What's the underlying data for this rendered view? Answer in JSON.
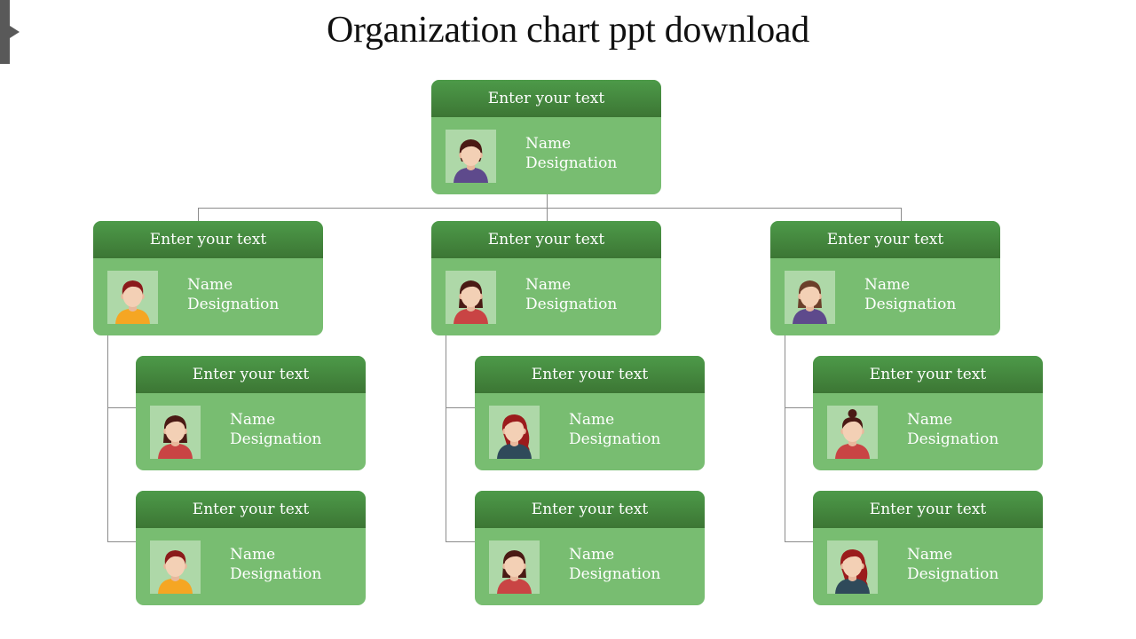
{
  "title": "Organization chart ppt download",
  "colors": {
    "card_body": "#78bd71",
    "card_header_top": "#4d9a49",
    "card_header_bottom": "#3c7634",
    "avatar_bg": "#aed8a8",
    "connector": "#8c8c8c"
  },
  "cards": [
    {
      "header": "Enter your text",
      "name": "Name",
      "designation": "Designation",
      "avatar": "woman-short-dark-hair-purple-shirt"
    },
    {
      "header": "Enter your text",
      "name": "Name",
      "designation": "Designation",
      "avatar": "man-red-hair-yellow-shirt"
    },
    {
      "header": "Enter your text",
      "name": "Name",
      "designation": "Designation",
      "avatar": "woman-dark-hair-red-shirt"
    },
    {
      "header": "Enter your text",
      "name": "Name",
      "designation": "Designation",
      "avatar": "woman-brown-hair-purple-shirt"
    },
    {
      "header": "Enter your text",
      "name": "Name",
      "designation": "Designation",
      "avatar": "woman-dark-hair-red-shirt"
    },
    {
      "header": "Enter your text",
      "name": "Name",
      "designation": "Designation",
      "avatar": "man-red-hair-yellow-shirt"
    },
    {
      "header": "Enter your text",
      "name": "Name",
      "designation": "Designation",
      "avatar": "woman-long-red-hair-navy-shirt"
    },
    {
      "header": "Enter your text",
      "name": "Name",
      "designation": "Designation",
      "avatar": "woman-dark-hair-red-shirt"
    },
    {
      "header": "Enter your text",
      "name": "Name",
      "designation": "Designation",
      "avatar": "woman-bun-hair-red-shirt"
    },
    {
      "header": "Enter your text",
      "name": "Name",
      "designation": "Designation",
      "avatar": "woman-long-red-hair-navy-shirt"
    }
  ]
}
